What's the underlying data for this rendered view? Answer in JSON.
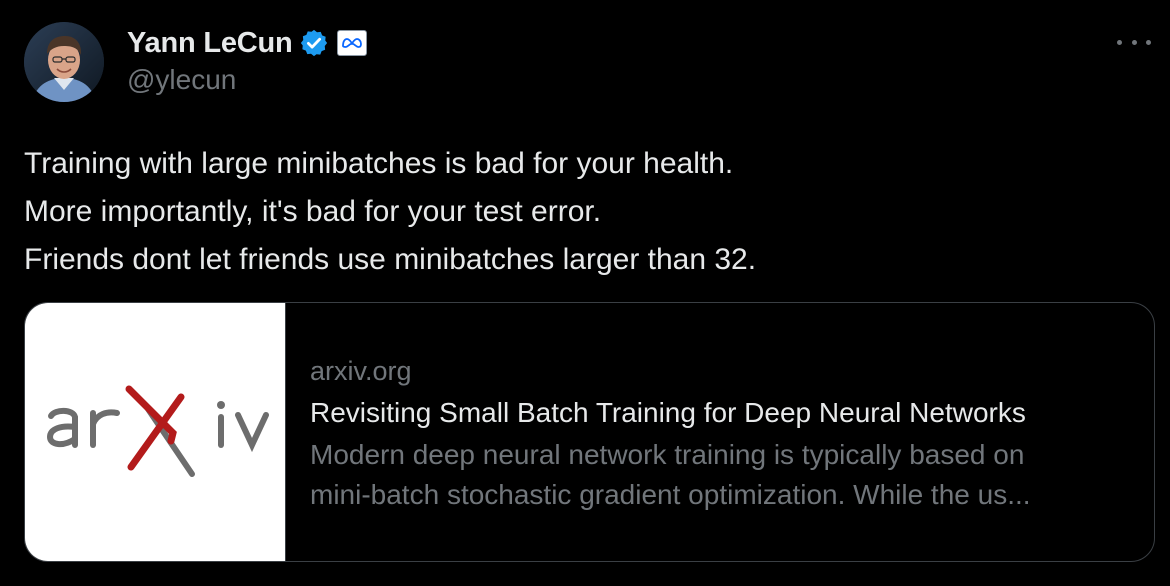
{
  "author": {
    "display_name": "Yann LeCun",
    "handle": "@ylecun",
    "avatar_icon": "avatar-photo",
    "verified_icon": "verified-badge-icon",
    "verified_color": "#1d9bf0",
    "affiliate_icon": "meta-logo-icon",
    "affiliate_color": "#0866ff"
  },
  "more_icon": "more-options-icon",
  "tweet": {
    "lines": [
      "Training with large minibatches is bad for your health.",
      "More importantly, it's bad for your test error.",
      "Friends dont let friends use minibatches larger than 32."
    ]
  },
  "link_card": {
    "thumbnail_logo_text": "arxiv",
    "thumbnail_colors": {
      "letters": "#6d6d6d",
      "x_accent": "#b31b1b"
    },
    "domain": "arxiv.org",
    "title": "Revisiting Small Batch Training for Deep Neural Networks",
    "description_lines": [
      "Modern deep neural network training is typically based on",
      "mini-batch stochastic gradient optimization. While the us..."
    ]
  },
  "colors": {
    "background": "#000000",
    "primary_text": "#e7e9ea",
    "secondary_text": "#71767b",
    "border": "#3a3f44"
  }
}
